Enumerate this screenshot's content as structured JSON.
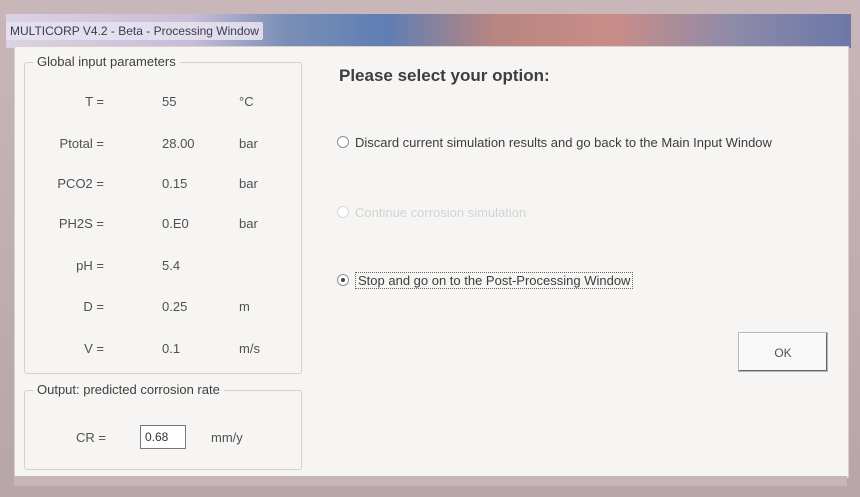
{
  "window": {
    "title": "MULTICORP V4.2 - Beta - Processing Window"
  },
  "global_inputs": {
    "title": "Global input parameters",
    "rows": [
      {
        "label": "T =",
        "value": "55",
        "unit": "°C"
      },
      {
        "label": "Ptotal =",
        "value": "28.00",
        "unit": "bar"
      },
      {
        "label": "PCO2 =",
        "value": "0.15",
        "unit": "bar"
      },
      {
        "label": "PH2S =",
        "value": "0.E0",
        "unit": "bar"
      },
      {
        "label": "pH =",
        "value": "5.4",
        "unit": ""
      },
      {
        "label": "D =",
        "value": "0.25",
        "unit": "m"
      },
      {
        "label": "V =",
        "value": "0.1",
        "unit": "m/s"
      }
    ]
  },
  "output": {
    "title": "Output: predicted corrosion rate",
    "cr_label": "CR =",
    "cr_value": "0.68",
    "cr_unit": "mm/y"
  },
  "prompt": "Please select your option:",
  "options": [
    {
      "label": "Discard current simulation results and go back to the Main Input Window",
      "selected": false,
      "enabled": true
    },
    {
      "label": "Continue corrosion simulation",
      "selected": false,
      "enabled": false
    },
    {
      "label": "Stop and go on to the Post-Processing Window",
      "selected": true,
      "enabled": true
    }
  ],
  "buttons": {
    "ok": "OK"
  }
}
